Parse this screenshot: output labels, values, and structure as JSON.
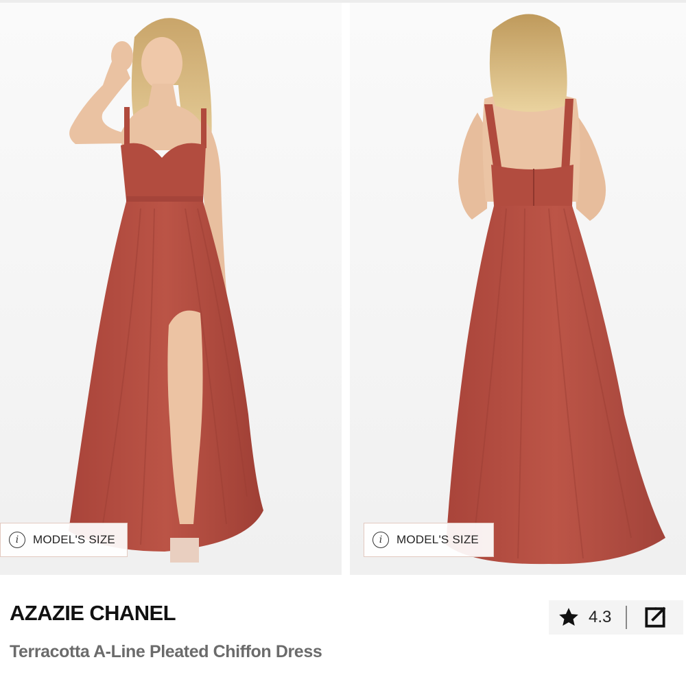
{
  "gallery": {
    "images": [
      {
        "view": "front",
        "alt": "model wearing dress, front view"
      },
      {
        "view": "back",
        "alt": "model wearing dress, back view"
      }
    ],
    "model_size_label": "MODEL'S SIZE",
    "info_glyph": "i"
  },
  "product": {
    "brand": "AZAZIE CHANEL",
    "name": "Terracotta A-Line Pleated Chiffon Dress",
    "rating": "4.3"
  },
  "colors": {
    "dress": "#b24a3c",
    "background": "#ffffff",
    "text_primary": "#111111",
    "text_secondary": "#6b6b6b",
    "rating_bg": "#f4f4f4"
  },
  "icons": {
    "info": "info-icon",
    "star": "star-icon",
    "share": "external-link-icon"
  }
}
